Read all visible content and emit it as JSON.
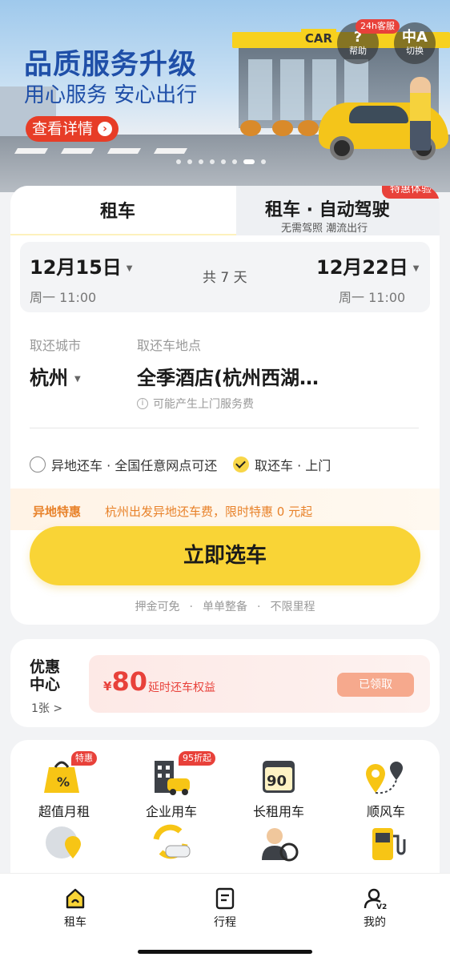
{
  "banner": {
    "title": "品质服务升级",
    "subtitle": "用心服务 安心出行",
    "cta": "查看详情",
    "sign": "CAR",
    "help_badge": "24h客服",
    "help_label": "帮助",
    "switch_label": "切换"
  },
  "tabs": {
    "rental": "租车",
    "autonomous": "租车 · 自动驾驶",
    "autonomous_sub": "无需驾照 潮流出行",
    "promo_badge": "特惠体验"
  },
  "dates": {
    "pickup_date": "12月15日",
    "pickup_time": "周一 11:00",
    "duration": "共 7 天",
    "return_date": "12月22日",
    "return_time": "周一 11:00"
  },
  "location": {
    "city_label": "取还城市",
    "city": "杭州",
    "place_label": "取还车地点",
    "place": "全季酒店(杭州西湖…",
    "note": "可能产生上门服务费"
  },
  "options": {
    "different_return": "异地还车 · 全国任意网点可还",
    "door_service": "取还车 · 上门"
  },
  "special": {
    "tag": "异地特惠",
    "text": "杭州出发异地还车费，限时特惠 0 元起"
  },
  "cta": {
    "label": "立即选车"
  },
  "features": [
    "押金可免",
    "单单整备",
    "不限里程"
  ],
  "feature_sep": "·",
  "coupon": {
    "title_line1": "优惠",
    "title_line2": "中心",
    "count": "1张 >",
    "currency": "¥",
    "amount": "80",
    "desc": "延时还车权益",
    "button": "已领取"
  },
  "services": [
    {
      "label": "超值月租",
      "tag": "特惠",
      "icon": "monthly-rental-icon"
    },
    {
      "label": "企业用车",
      "tag": "95折起",
      "icon": "enterprise-icon"
    },
    {
      "label": "长租用车",
      "tag": "",
      "icon": "long-rental-icon"
    },
    {
      "label": "顺风车",
      "tag": "",
      "icon": "ride-share-icon"
    },
    {
      "label": "",
      "tag": "",
      "icon": "global-rental-icon"
    },
    {
      "label": "",
      "tag": "",
      "icon": "used-car-icon"
    },
    {
      "label": "",
      "tag": "",
      "icon": "chauffeur-icon"
    },
    {
      "label": "",
      "tag": "",
      "icon": "fuel-icon"
    }
  ],
  "nav": {
    "rental": "租车",
    "trips": "行程",
    "mine": "我的"
  },
  "colors": {
    "accent_yellow": "#f9d436",
    "promo_red": "#e8413a",
    "special_orange": "#e8822a",
    "banner_blue": "#1f4fa8"
  }
}
